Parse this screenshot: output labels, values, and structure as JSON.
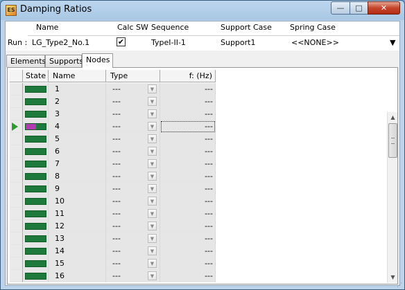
{
  "window": {
    "title": "Damping Ratios",
    "icon": "app-icon",
    "controls": {
      "minimize": "—",
      "maximize": "□",
      "close": "✕"
    }
  },
  "run": {
    "label": "Run :",
    "headers": {
      "name": "Name",
      "calc_sw": "Calc SW",
      "sequence": "Sequence",
      "support_case": "Support Case",
      "spring_case": "Spring Case"
    },
    "values": {
      "name": "LG_Type2_No.1",
      "calc_sw": "✔",
      "sequence": "TypeI-II-1",
      "support_case": "Support1",
      "spring_case": "<<NONE>>"
    }
  },
  "tabs": [
    {
      "label": "Elements",
      "active": false
    },
    {
      "label": "Supports",
      "active": false
    },
    {
      "label": "Nodes",
      "active": true
    }
  ],
  "grid": {
    "headers": {
      "state": "State",
      "name": "Name",
      "type": "Type",
      "f": "f: (Hz)"
    },
    "rows": [
      {
        "name": "1",
        "type": "---",
        "f": "---",
        "state": "complete",
        "selected": false
      },
      {
        "name": "2",
        "type": "---",
        "f": "---",
        "state": "complete",
        "selected": false
      },
      {
        "name": "3",
        "type": "---",
        "f": "---",
        "state": "complete",
        "selected": false
      },
      {
        "name": "4",
        "type": "---",
        "f": "---",
        "state": "partial",
        "selected": true
      },
      {
        "name": "5",
        "type": "---",
        "f": "---",
        "state": "complete",
        "selected": false
      },
      {
        "name": "6",
        "type": "---",
        "f": "---",
        "state": "complete",
        "selected": false
      },
      {
        "name": "7",
        "type": "---",
        "f": "---",
        "state": "complete",
        "selected": false
      },
      {
        "name": "8",
        "type": "---",
        "f": "---",
        "state": "complete",
        "selected": false
      },
      {
        "name": "9",
        "type": "---",
        "f": "---",
        "state": "complete",
        "selected": false
      },
      {
        "name": "10",
        "type": "---",
        "f": "---",
        "state": "complete",
        "selected": false
      },
      {
        "name": "11",
        "type": "---",
        "f": "---",
        "state": "complete",
        "selected": false
      },
      {
        "name": "12",
        "type": "---",
        "f": "---",
        "state": "complete",
        "selected": false
      },
      {
        "name": "13",
        "type": "---",
        "f": "---",
        "state": "complete",
        "selected": false
      },
      {
        "name": "14",
        "type": "---",
        "f": "---",
        "state": "complete",
        "selected": false
      },
      {
        "name": "15",
        "type": "---",
        "f": "---",
        "state": "complete",
        "selected": false
      },
      {
        "name": "16",
        "type": "---",
        "f": "---",
        "state": "complete",
        "selected": false
      }
    ]
  },
  "colors": {
    "state_complete": "#1d7a3c",
    "state_partial": "#b03cb0",
    "selection_arrow": "#2f9a2f"
  }
}
